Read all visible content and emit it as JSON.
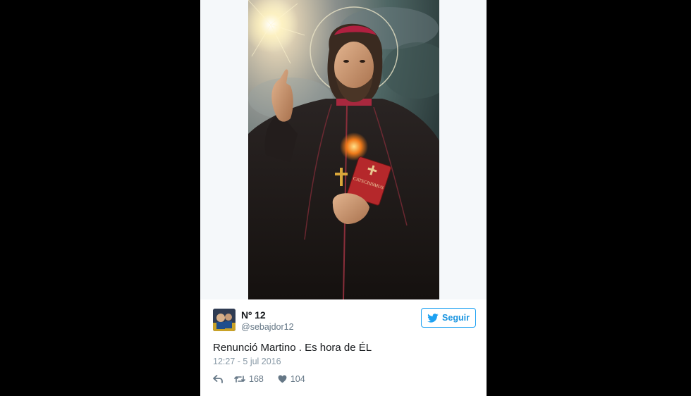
{
  "tweet": {
    "display_name": "Nº 12",
    "handle": "@sebajdor12",
    "text": "Renunció Martino . Es hora de ÉL",
    "timestamp": "12:27 - 5 jul 2016",
    "follow_label": "Seguir",
    "retweet_count": "168",
    "like_count": "104",
    "book_title": "CATECHISMUS"
  },
  "icons": {
    "follow": "twitter-bird-icon",
    "reply": "reply-arrow-icon",
    "retweet": "retweet-icon",
    "like": "heart-icon"
  },
  "colors": {
    "accent": "#1da1f2",
    "text": "#14171a",
    "muted": "#657786",
    "background": "#000000",
    "card": "#ffffff"
  }
}
